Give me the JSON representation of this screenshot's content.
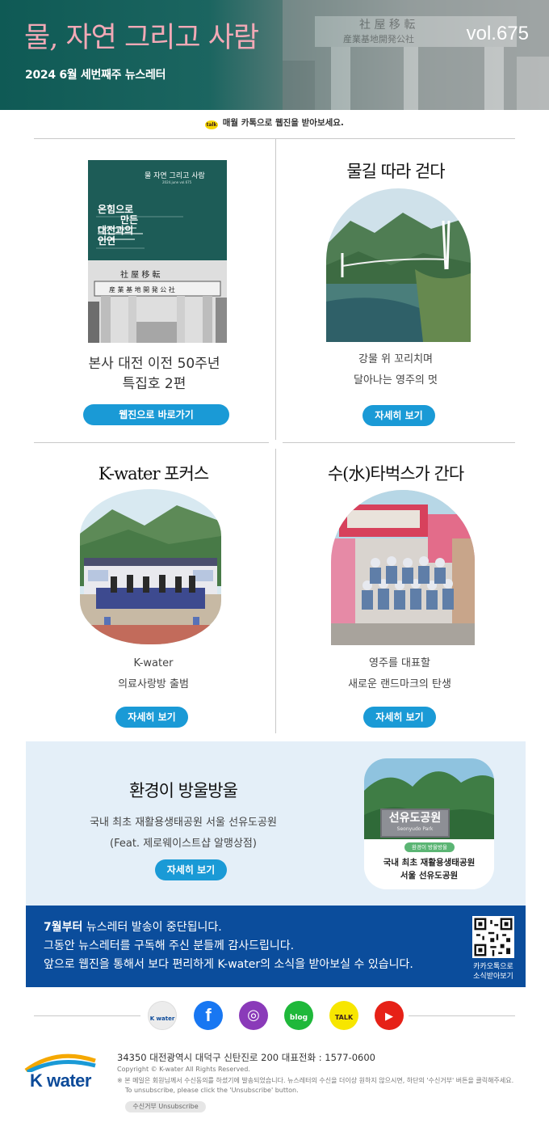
{
  "header": {
    "title": "물, 자연 그리고 사람",
    "subtitle": "2024 6월 세번째주 뉴스레터",
    "volume": "vol.675"
  },
  "kakao_note": "매월 카톡으로 웹진을 받아보세요.",
  "cards": {
    "magazine": {
      "cover_title": "물 자연 그리고 사람",
      "cover_issue": "2024.june  vol.675",
      "cover_headline": [
        "온힘으로",
        "만든",
        "대전과의",
        "인연"
      ],
      "gate_sign": [
        "社 屋 移 転",
        "産 業 基 地 開 発 公 社"
      ],
      "caption": [
        "본사 대전 이전 50주년",
        "특집호 2편"
      ],
      "button": "웹진으로 바로가기"
    },
    "water_road": {
      "title": "물길 따라 걷다",
      "caption": [
        "강물 위 꼬리치며",
        "달아나는 영주의 멋"
      ],
      "button": "자세히 보기"
    },
    "focus": {
      "title": "K-water 포커스",
      "caption": [
        "K-water",
        "의료사랑방 출범"
      ],
      "button": "자세히 보기"
    },
    "tabex": {
      "title": "수(水)타벅스가 간다",
      "caption": [
        "영주를 대표할",
        "새로운 랜드마크의 탄생"
      ],
      "button": "자세히 보기"
    }
  },
  "environment": {
    "title": "환경이 방울방울",
    "lines": [
      "국내 최초 재활용생태공원 서울 선유도공원",
      "(Feat. 제로웨이스트샵 알맹상점)"
    ],
    "button": "자세히 보기",
    "photo_sign": "선유도공원",
    "photo_sign_sub": "Seonyudo Park",
    "photo_badge": "환경이 방울방울",
    "photo_caption": [
      "국내 최초 재활용생태공원",
      "서울 선유도공원"
    ]
  },
  "notice": {
    "line1_bold": "7월부터",
    "line1_rest": " 뉴스레터 발송이 중단됩니다.",
    "line2": "그동안 뉴스레터를 구독해 주신 분들께 감사드립니다.",
    "line3": "앞으로 웹진을 통해서 보다 편리하게 K-water의 소식을 받아보실 수 있습니다.",
    "qr_caption": [
      "카카오톡으로",
      "소식받아보기"
    ]
  },
  "social": [
    {
      "name": "kwater-icon",
      "label": "K water",
      "color": "#f2f2f2"
    },
    {
      "name": "facebook-icon",
      "label": "f",
      "color": "#1877f2"
    },
    {
      "name": "instagram-icon",
      "label": "◎",
      "color": "#8a3ab9"
    },
    {
      "name": "blog-icon",
      "label": "blog",
      "color": "#1fb83a"
    },
    {
      "name": "kakaotalk-icon",
      "label": "TALK",
      "color": "#f7e600"
    },
    {
      "name": "youtube-icon",
      "label": "▶",
      "color": "#e62117"
    }
  ],
  "footer": {
    "address": "34350 대전광역시 대덕구 신탄진로 200  대표전화 : 1577-0600",
    "copyright": "Copyright © K-water All Rights Reserved.",
    "notice1": "※ 본 메일은 회원님께서 수신동의를 하셨기에 발송되었습니다. 뉴스레터의 수신을 더이상 원하지 않으시면, 하단의 '수신거부' 버튼을 클릭해주세요.",
    "notice2": "To unsubscribe, please click the 'Unsubscribe' button.",
    "unsubscribe": "수신거부  Unsubscribe",
    "logo": "K water"
  }
}
